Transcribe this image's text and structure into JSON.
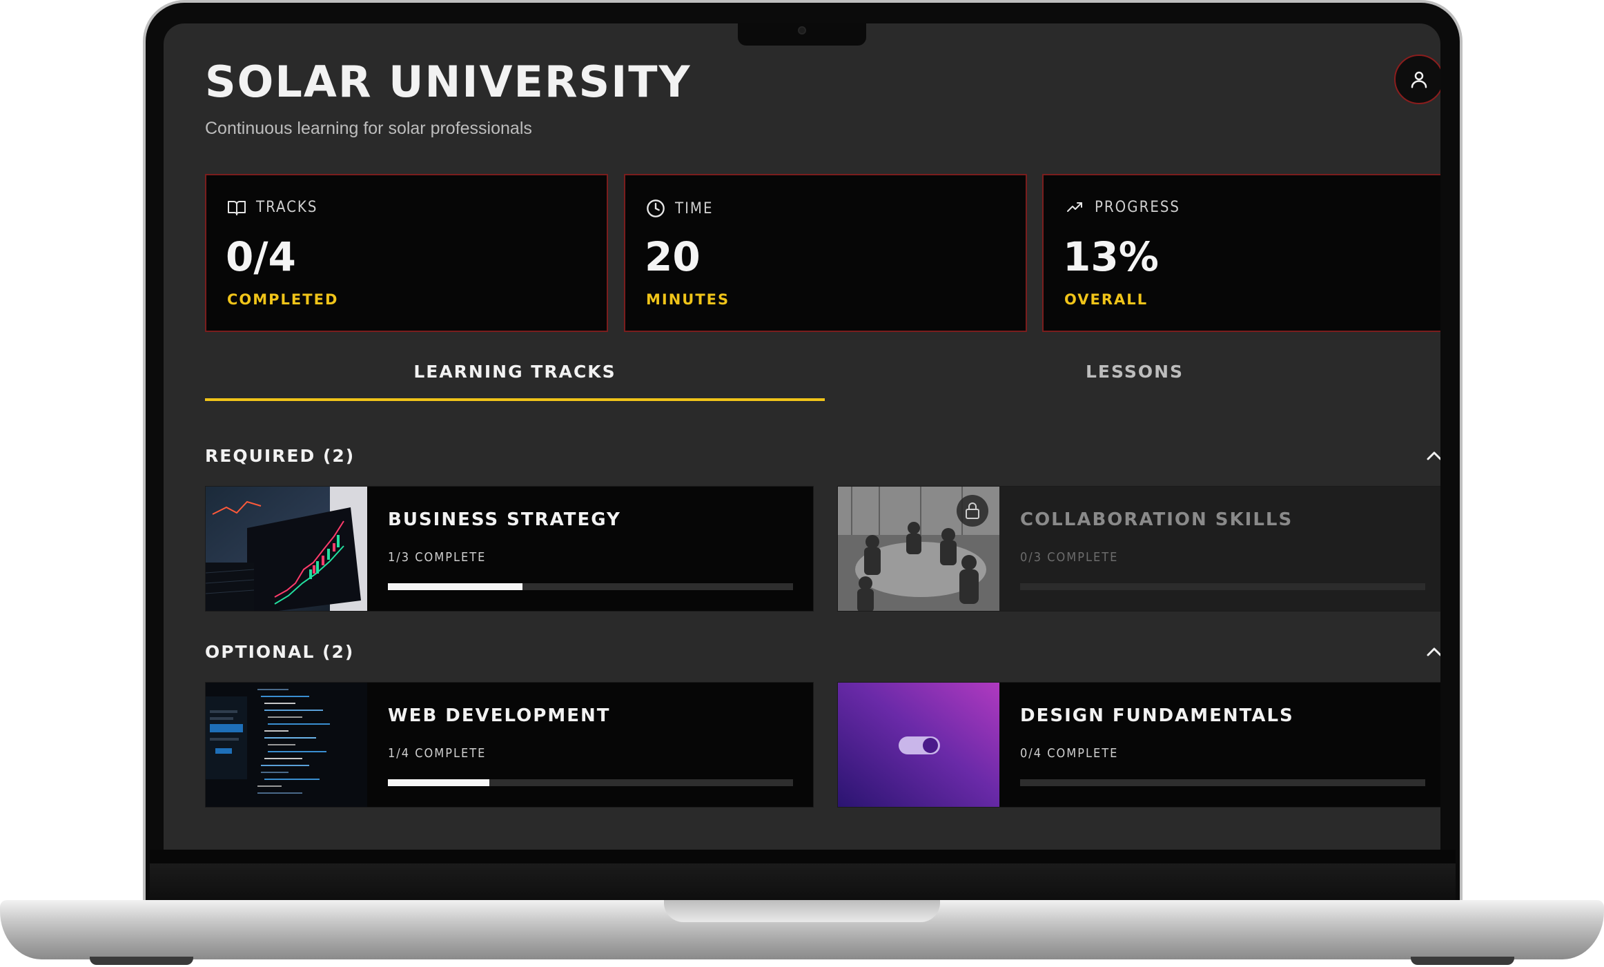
{
  "app": {
    "title": "SOLAR UNIVERSITY",
    "subtitle": "Continuous learning for solar professionals",
    "profile_icon": "user-icon"
  },
  "stats": [
    {
      "label": "TRACKS",
      "value": "0/4",
      "sub": "COMPLETED",
      "icon": "book-icon"
    },
    {
      "label": "TIME",
      "value": "20",
      "sub": "MINUTES",
      "icon": "clock-icon"
    },
    {
      "label": "PROGRESS",
      "value": "13%",
      "sub": "OVERALL",
      "icon": "trending-up-icon"
    }
  ],
  "tabs": [
    {
      "label": "LEARNING TRACKS",
      "active": true
    },
    {
      "label": "LESSONS",
      "active": false
    }
  ],
  "sections": [
    {
      "heading": "REQUIRED (2)",
      "tracks": [
        {
          "name": "BUSINESS STRATEGY",
          "progress_text": "1/3 COMPLETE",
          "progress": 0.333,
          "locked": false,
          "thumbnail": "trading-chart-laptop"
        },
        {
          "name": "COLLABORATION SKILLS",
          "progress_text": "0/3 COMPLETE",
          "progress": 0,
          "locked": true,
          "thumbnail": "team-meeting"
        }
      ]
    },
    {
      "heading": "OPTIONAL (2)",
      "tracks": [
        {
          "name": "WEB DEVELOPMENT",
          "progress_text": "1/4 COMPLETE",
          "progress": 0.25,
          "locked": false,
          "thumbnail": "code-editor"
        },
        {
          "name": "DESIGN FUNDAMENTALS",
          "progress_text": "0/4 COMPLETE",
          "progress": 0,
          "locked": false,
          "thumbnail": "toggle-switch-purple"
        }
      ]
    }
  ],
  "colors": {
    "accent": "#f0c419",
    "card_border": "#7a1d1d",
    "background": "#2a2a2a",
    "card_bg": "#060606"
  }
}
